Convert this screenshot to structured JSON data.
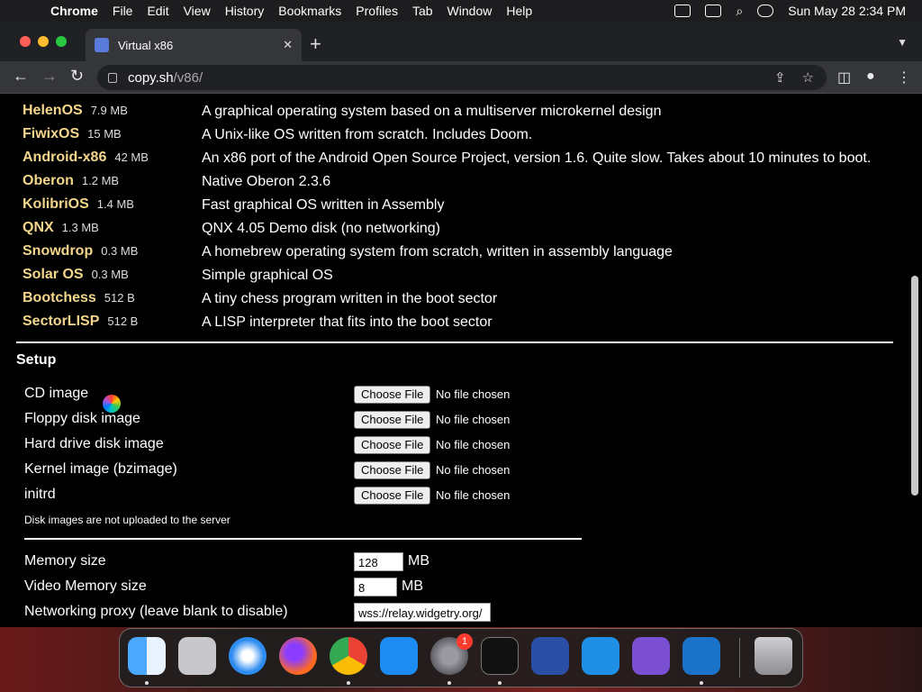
{
  "menubar": {
    "app": "Chrome",
    "items": [
      "File",
      "Edit",
      "View",
      "History",
      "Bookmarks",
      "Profiles",
      "Tab",
      "Window",
      "Help"
    ],
    "clock": "Sun May 28  2:34 PM"
  },
  "browser": {
    "tab_title": "Virtual x86",
    "url_host": "copy.sh",
    "url_path": "/v86/"
  },
  "os_list": [
    {
      "name": "HelenOS",
      "size": "7.9 MB",
      "desc": "A graphical operating system based on a multiserver microkernel design"
    },
    {
      "name": "FiwixOS",
      "size": "15 MB",
      "desc": "A Unix-like OS written from scratch. Includes Doom."
    },
    {
      "name": "Android-x86",
      "size": "42 MB",
      "desc": "An x86 port of the Android Open Source Project, version 1.6. Quite slow. Takes about 10 minutes to boot."
    },
    {
      "name": "Oberon",
      "size": "1.2 MB",
      "desc": "Native Oberon 2.3.6"
    },
    {
      "name": "KolibriOS",
      "size": "1.4 MB",
      "desc": "Fast graphical OS written in Assembly"
    },
    {
      "name": "QNX",
      "size": "1.3 MB",
      "desc": "QNX 4.05 Demo disk (no networking)"
    },
    {
      "name": "Snowdrop",
      "size": "0.3 MB",
      "desc": "A homebrew operating system from scratch, written in assembly language"
    },
    {
      "name": "Solar OS",
      "size": "0.3 MB",
      "desc": "Simple graphical OS"
    },
    {
      "name": "Bootchess",
      "size": "512 B",
      "desc": "A tiny chess program written in the boot sector"
    },
    {
      "name": "SectorLISP",
      "size": "512 B",
      "desc": "A LISP interpreter that fits into the boot sector"
    }
  ],
  "setup": {
    "title": "Setup",
    "file_inputs": [
      {
        "label": "CD image",
        "button": "Choose File",
        "status": "No file chosen"
      },
      {
        "label": "Floppy disk image",
        "button": "Choose File",
        "status": "No file chosen"
      },
      {
        "label": "Hard drive disk image",
        "button": "Choose File",
        "status": "No file chosen"
      },
      {
        "label": "Kernel image (bzimage)",
        "button": "Choose File",
        "status": "No file chosen"
      },
      {
        "label": "initrd",
        "button": "Choose File",
        "status": "No file chosen"
      }
    ],
    "disk_note": "Disk images are not uploaded to the server",
    "memory": {
      "label": "Memory size",
      "value": "128",
      "unit": "MB"
    },
    "video_memory": {
      "label": "Video Memory size",
      "value": "8",
      "unit": "MB"
    },
    "proxy": {
      "label": "Networking proxy (leave blank to disable)",
      "value": "wss://relay.widgetry.org/"
    }
  },
  "dock": {
    "apps": [
      "finder-icon",
      "launchpad-icon",
      "safari-icon",
      "firefox-icon",
      "chrome-icon",
      "app-store-icon",
      "system-settings-icon",
      "terminal-icon",
      "remote-desktop-icon",
      "vscode-icon",
      "visual-studio-icon",
      "teamviewer-icon",
      "trash-icon"
    ],
    "settings_badge": "1"
  }
}
